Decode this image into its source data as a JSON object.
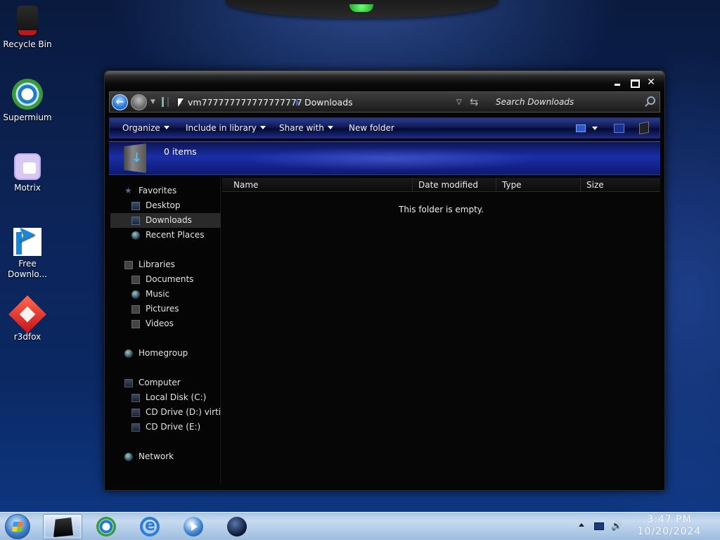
{
  "desktop": {
    "icons": [
      {
        "label": "Recycle Bin",
        "icon": "recycle-bin-icon"
      },
      {
        "label": "Supermium",
        "icon": "supermium-icon"
      },
      {
        "label": "Motrix",
        "icon": "motrix-icon"
      },
      {
        "label": "Free Downlo...",
        "icon": "free-download-manager-icon"
      },
      {
        "label": "r3dfox",
        "icon": "r3dfox-icon"
      }
    ]
  },
  "window": {
    "breadcrumb": [
      "vm777777777777777777",
      "Downloads"
    ],
    "search_placeholder": "Search Downloads",
    "toolbar": {
      "organize": "Organize",
      "include_in_library": "Include in library",
      "share_with": "Share with",
      "new_folder": "New folder"
    },
    "info": {
      "item_count": "0 items"
    },
    "nav": {
      "favorites": "Favorites",
      "favorites_items": [
        "Desktop",
        "Downloads",
        "Recent Places"
      ],
      "libraries": "Libraries",
      "libraries_items": [
        "Documents",
        "Music",
        "Pictures",
        "Videos"
      ],
      "homegroup": "Homegroup",
      "computer": "Computer",
      "computer_items": [
        "Local Disk (C:)",
        "CD Drive (D:) virtio-win",
        "CD Drive (E:)"
      ],
      "network": "Network",
      "selected": "Downloads"
    },
    "columns": [
      "Name",
      "Date modified",
      "Type",
      "Size"
    ],
    "empty_message": "This folder is empty."
  },
  "taskbar": {
    "apps": [
      "windows-explorer",
      "supermium",
      "internet-explorer",
      "windows-media-player",
      "globe-app"
    ],
    "active_app": "windows-explorer",
    "clock": {
      "time": "3:47 PM",
      "date": "10/20/2024"
    }
  },
  "colors": {
    "window_bg": "#060606",
    "toolbar_blue": "#1b2b88",
    "taskbar": "#a9c6e6"
  }
}
